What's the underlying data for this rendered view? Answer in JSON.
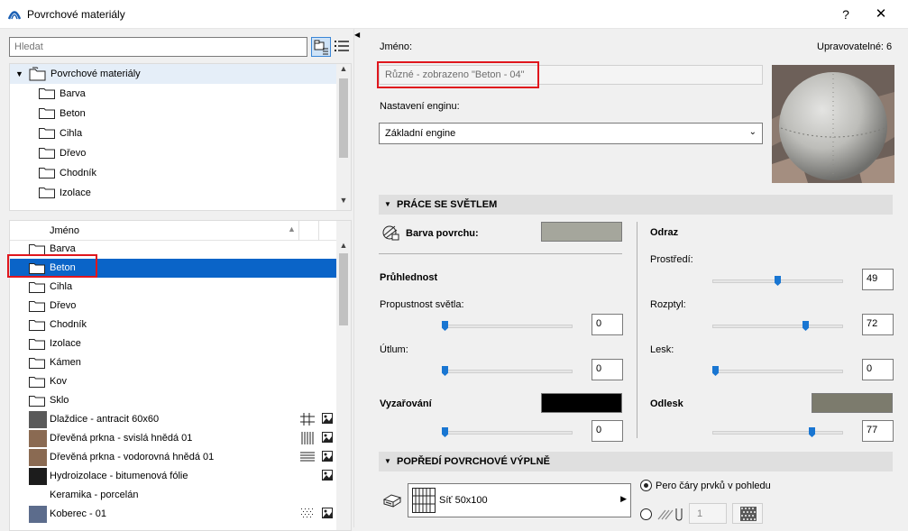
{
  "window": {
    "title": "Povrchové materiály",
    "help": "?",
    "close": "✕"
  },
  "search": {
    "placeholder": "Hledat"
  },
  "tree": {
    "root": "Povrchové materiály",
    "items": [
      "Barva",
      "Beton",
      "Cihla",
      "Dřevo",
      "Chodník",
      "Izolace"
    ]
  },
  "list": {
    "header": "Jméno",
    "folders": [
      "Barva",
      "Beton",
      "Cihla",
      "Dřevo",
      "Chodník",
      "Izolace",
      "Kámen",
      "Kov",
      "Sklo"
    ],
    "selected": "Beton",
    "materials": [
      {
        "name": "Dlaždice - antracit 60x60",
        "color": "#5a5a5a",
        "pattern": "grid"
      },
      {
        "name": "Dřevěná prkna - svislá hnědá 01",
        "color": "#8a6a52",
        "pattern": "vertical"
      },
      {
        "name": "Dřevěná prkna - vodorovná hnědá 01",
        "color": "#8a6a52",
        "pattern": "horizontal"
      },
      {
        "name": "Hydroizolace - bitumenová fólie",
        "color": "#1c1c1c",
        "pattern": ""
      },
      {
        "name": "Keramika - porcelán",
        "color": "",
        "pattern": ""
      },
      {
        "name": "Koberec - 01",
        "color": "#5c6c8c",
        "pattern": "dots"
      }
    ]
  },
  "right": {
    "name_label": "Jméno:",
    "editable": "Upravovatelné: 6",
    "name_value": "Různé - zobrazeno \"Beton - 04\"",
    "engine_label": "Nastavení enginu:",
    "engine_value": "Základní engine",
    "light_section": "PRÁCE SE SVĚTLEM",
    "surface_color_label": "Barva povrchu:",
    "surface_color": "#a5a69c",
    "transparency_title": "Průhlednost",
    "light_transmission_label": "Propustnost světla:",
    "light_transmission": "0",
    "attenuation_label": "Útlum:",
    "attenuation": "0",
    "emission_label": "Vyzařování",
    "emission": "0",
    "emission_color": "#000000",
    "reflection_title": "Odraz",
    "ambient_label": "Prostředí:",
    "ambient": "49",
    "diffuse_label": "Rozptyl:",
    "diffuse": "72",
    "shine_label": "Lesk:",
    "shine": "0",
    "specular_label": "Odlesk",
    "specular": "77",
    "specular_color": "#7c7b6d",
    "fill_section": "POPŘEDÍ POVRCHOVÉ VÝPLNĚ",
    "fill_value": "Síť 50x100",
    "pen_option": "Pero čáry prvků v pohledu",
    "pen_number": "1"
  },
  "colors": {
    "accent": "#0a64c8",
    "highlight": "#e0161d"
  }
}
